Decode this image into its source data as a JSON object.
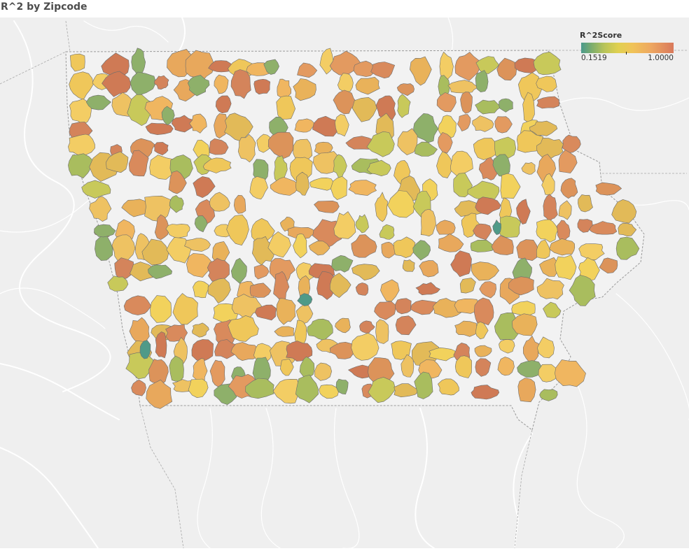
{
  "title": "R^2 by Zipcode",
  "legend": {
    "title": "R^2Score",
    "min_label": "0.1519",
    "max_label": "1.0000",
    "min_value": 0.1519,
    "max_value": 1.0,
    "colors": [
      "#4a9a8c",
      "#b8c45a",
      "#f0c458",
      "#d9795c"
    ]
  },
  "colors": {
    "background": "#f1f1f1",
    "land": "#ebebeb",
    "rivers": "#ffffff",
    "borders": "#9a9a9a",
    "zip_outline": "#6e6e6e"
  }
}
